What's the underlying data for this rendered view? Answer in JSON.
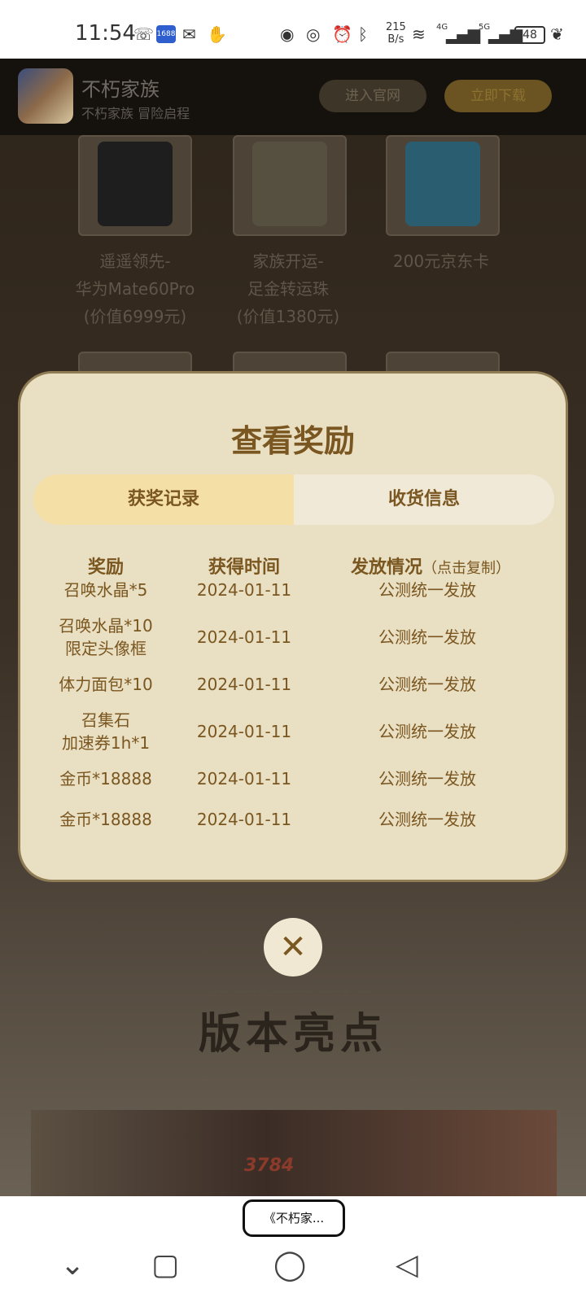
{
  "status_bar": {
    "time": "11:54",
    "net_speed_value": "215",
    "net_speed_unit": "B/s",
    "battery": "48",
    "signal_4g": "4G",
    "signal_5g": "5G",
    "app_badge": "1688"
  },
  "banner": {
    "app_name": "不朽家族",
    "slogan": "不朽家族 冒险启程",
    "official_button": "进入官网",
    "download_button": "立即下载"
  },
  "prizes": [
    {
      "line1": "遥遥领先-",
      "line2": "华为Mate60Pro",
      "line3": "(价值6999元)"
    },
    {
      "line1": "家族开运-",
      "line2": "足金转运珠",
      "line3": "(价值1380元)"
    },
    {
      "line1": "200元京东卡",
      "line2": "",
      "line3": ""
    }
  ],
  "modal": {
    "title": "查看奖励",
    "tabs": [
      "获奖记录",
      "收货信息"
    ],
    "headers": {
      "reward": "奖励",
      "time": "获得时间",
      "status": "发放情况",
      "status_hint": "（点击复制）"
    },
    "rows": [
      {
        "reward1": "召唤水晶*5",
        "reward2": "",
        "time": "2024-01-11",
        "status": "公测统一发放"
      },
      {
        "reward1": "召唤水晶*10",
        "reward2": "限定头像框",
        "time": "2024-01-11",
        "status": "公测统一发放"
      },
      {
        "reward1": "体力面包*10",
        "reward2": "",
        "time": "2024-01-11",
        "status": "公测统一发放"
      },
      {
        "reward1": "召集石",
        "reward2": "加速券1h*1",
        "time": "2024-01-11",
        "status": "公测统一发放"
      },
      {
        "reward1": "金币*18888",
        "reward2": "",
        "time": "2024-01-11",
        "status": "公测统一发放"
      },
      {
        "reward1": "金币*18888",
        "reward2": "",
        "time": "2024-01-11",
        "status": "公测统一发放"
      }
    ]
  },
  "section": {
    "title": "版本亮点",
    "number": "3784"
  },
  "bottom": {
    "pill_label": "《不朽家..."
  }
}
